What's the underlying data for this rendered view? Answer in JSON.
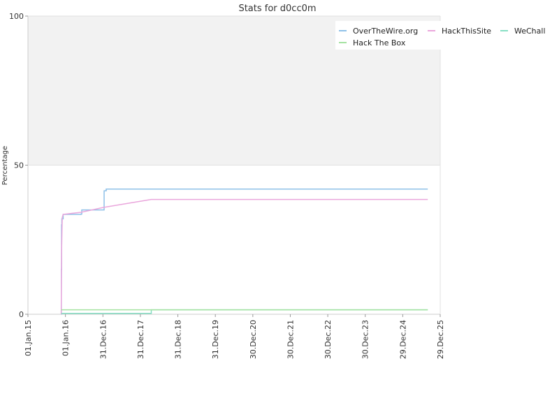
{
  "chart_data": {
    "type": "line",
    "title": "Stats for d0cc0m",
    "xlabel": "",
    "ylabel": "Percentage",
    "ylim": [
      0,
      100
    ],
    "xlim": [
      "2015-01-01",
      "2025-12-29"
    ],
    "y_ticks": [
      0,
      50,
      100
    ],
    "x_ticks": [
      {
        "date": "2015-01-01",
        "label": "01.Jan.15"
      },
      {
        "date": "2016-01-01",
        "label": "01.Jan.16"
      },
      {
        "date": "2016-12-31",
        "label": "31.Dec.16"
      },
      {
        "date": "2017-12-31",
        "label": "31.Dec.17"
      },
      {
        "date": "2018-12-31",
        "label": "31.Dec.18"
      },
      {
        "date": "2019-12-31",
        "label": "31.Dec.19"
      },
      {
        "date": "2020-12-30",
        "label": "30.Dec.20"
      },
      {
        "date": "2021-12-30",
        "label": "30.Dec.21"
      },
      {
        "date": "2022-12-30",
        "label": "30.Dec.22"
      },
      {
        "date": "2023-12-30",
        "label": "30.Dec.23"
      },
      {
        "date": "2024-12-29",
        "label": "29.Dec.24"
      },
      {
        "date": "2025-12-29",
        "label": "29.Dec.25"
      }
    ],
    "upper_band": {
      "from": 50,
      "to": 100,
      "color": "#f2f2f2"
    },
    "grid": false,
    "legend_position": "top-right",
    "series": [
      {
        "name": "OverTheWire.org",
        "color": "#8ec0e8",
        "step": true,
        "points": [
          [
            "2015-11-21",
            0
          ],
          [
            "2015-11-22",
            15
          ],
          [
            "2015-11-24",
            30
          ],
          [
            "2015-11-27",
            32
          ],
          [
            "2015-12-10",
            33.5
          ],
          [
            "2016-06-01",
            33.6
          ],
          [
            "2016-06-08",
            35
          ],
          [
            "2017-01-05",
            35
          ],
          [
            "2017-01-12",
            41.4
          ],
          [
            "2017-02-01",
            42
          ],
          [
            "2025-08-30",
            42
          ]
        ]
      },
      {
        "name": "HackThisSite",
        "color": "#eaa6dc",
        "step": false,
        "points": [
          [
            "2015-11-21",
            0
          ],
          [
            "2015-11-25",
            22
          ],
          [
            "2015-12-01",
            32.5
          ],
          [
            "2015-12-10",
            33.5
          ],
          [
            "2016-06-01",
            34.2
          ],
          [
            "2017-01-01",
            35.8
          ],
          [
            "2018-04-15",
            38.5
          ],
          [
            "2025-08-30",
            38.5
          ]
        ]
      },
      {
        "name": "WeChall",
        "color": "#86dfc4",
        "step": true,
        "points": [
          [
            "2015-11-21",
            0.3
          ],
          [
            "2018-04-15",
            0.3
          ],
          [
            "2018-04-16",
            1.5
          ],
          [
            "2025-08-30",
            1.5
          ]
        ]
      },
      {
        "name": "Hack The Box",
        "color": "#a4e2a0",
        "step": false,
        "points": [
          [
            "2015-11-21",
            1.5
          ],
          [
            "2025-08-30",
            1.5
          ]
        ]
      }
    ]
  }
}
